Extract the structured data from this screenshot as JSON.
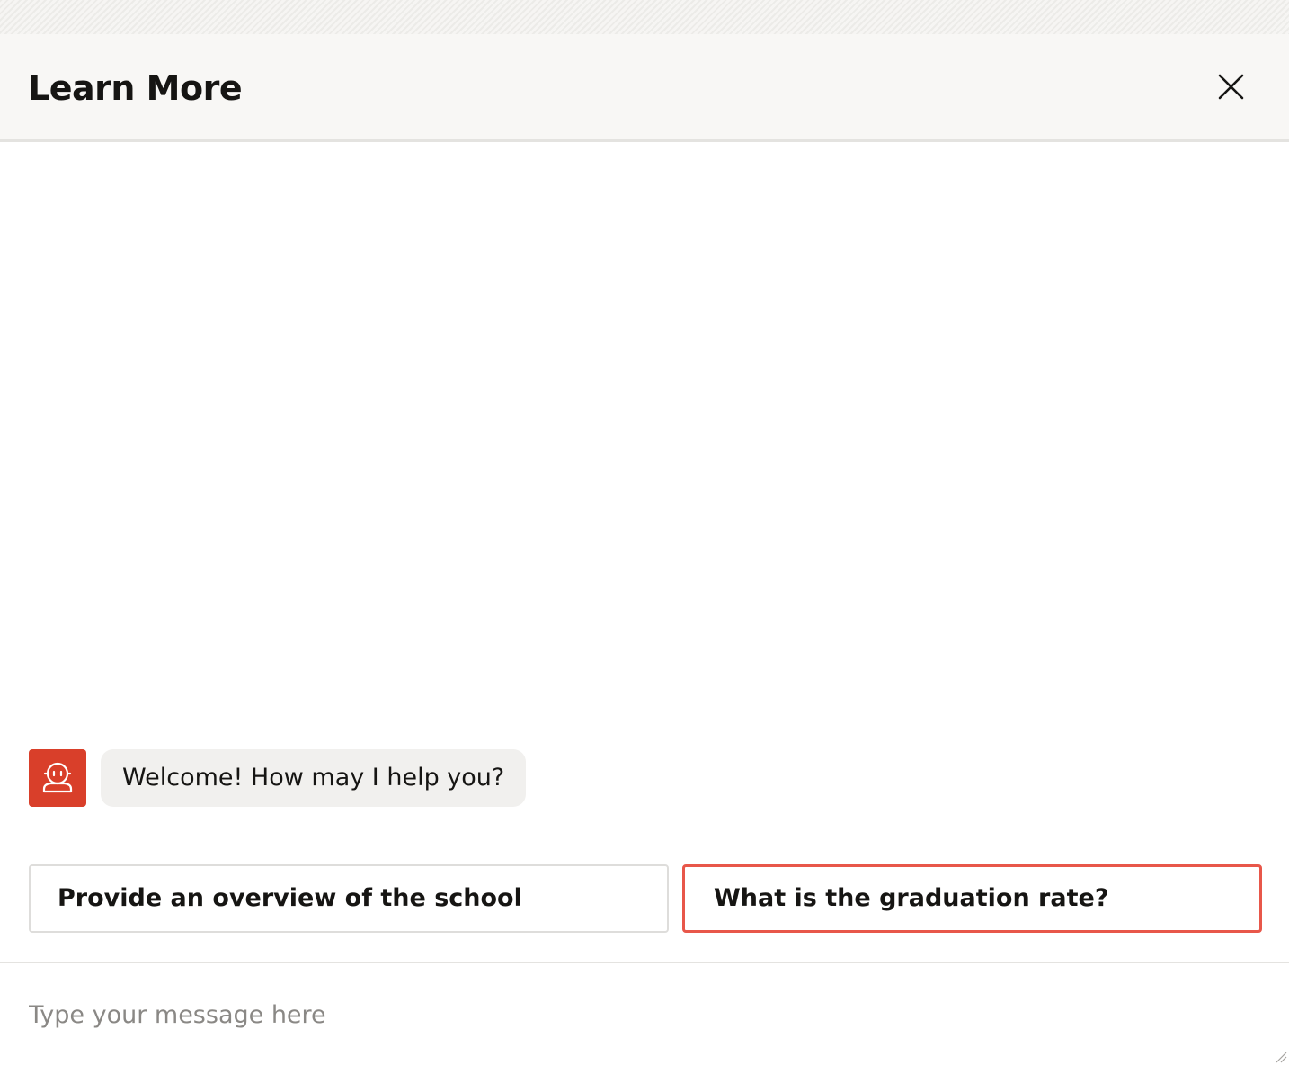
{
  "dialog": {
    "title": "Learn More",
    "close_icon": "close-icon"
  },
  "chat": {
    "bot_avatar_icon": "bot-agent-icon",
    "accent_color": "#d93f2a",
    "messages": [
      {
        "sender": "bot",
        "text": "Welcome! How may I help you?"
      }
    ],
    "actions": [
      {
        "label": "Provide an overview of the school"
      },
      {
        "label": "What is the graduation rate?",
        "highlighted": true
      }
    ],
    "highlight_color": "#e8574a"
  },
  "composer": {
    "placeholder": "Type your message here",
    "value": ""
  }
}
